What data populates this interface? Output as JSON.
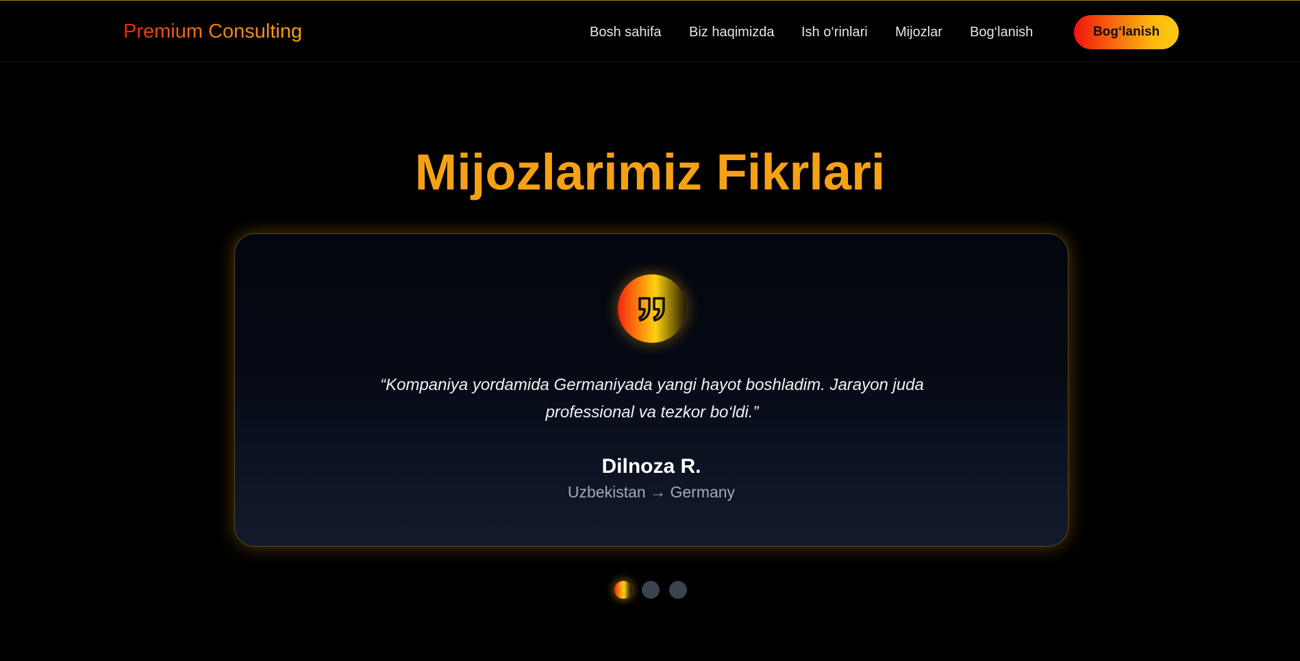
{
  "header": {
    "logo": "Premium Consulting",
    "nav": [
      {
        "label": "Bosh sahifa"
      },
      {
        "label": "Biz haqimizda"
      },
      {
        "label": "Ish o‘rinlari"
      },
      {
        "label": "Mijozlar"
      },
      {
        "label": "Bog‘lanish"
      }
    ],
    "cta_label": "Bog‘lanish"
  },
  "section": {
    "title": "Mijozlarimiz Fikrlari"
  },
  "testimonial": {
    "quote_icon": "quote-icon",
    "quote": "“Kompaniya yordamida Germaniyada yangi hayot boshladim. Jarayon juda professional va tezkor bo‘ldi.”",
    "author": "Dilnoza R.",
    "route": "Uzbekistan → Germany"
  },
  "carousel": {
    "total": 3,
    "active_index": 0
  },
  "colors": {
    "accent": "#f5a115",
    "brand_red": "#e8250f",
    "brand_yellow": "#ffcb10",
    "dot_inactive": "#3c4250",
    "background": "#000000"
  }
}
